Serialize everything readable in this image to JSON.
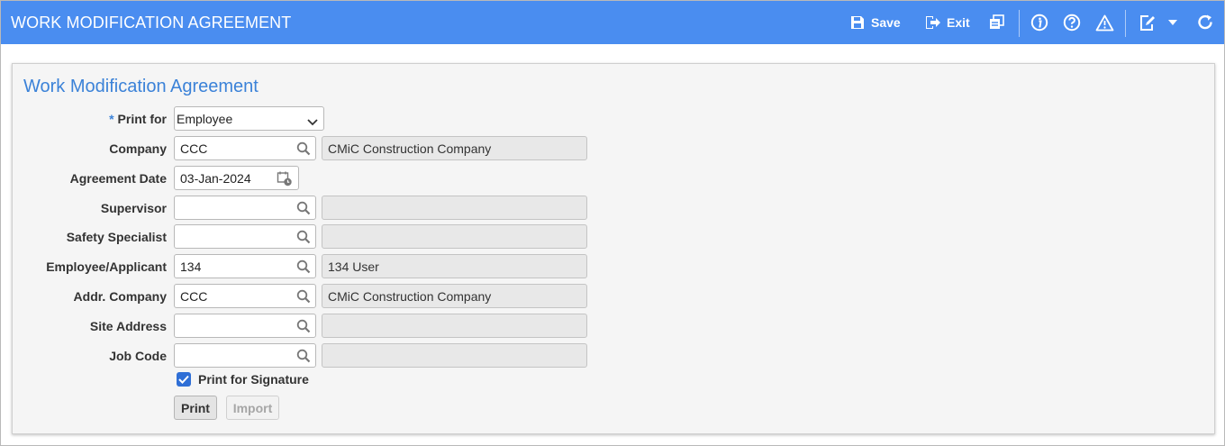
{
  "app": {
    "title": "WORK MODIFICATION AGREEMENT"
  },
  "toolbar": {
    "save_label": "Save",
    "exit_label": "Exit",
    "icons": [
      "save-icon",
      "exit-icon",
      "print-preview-icon",
      "info-icon",
      "help-icon",
      "warning-icon",
      "edit-note-icon",
      "dropdown-icon",
      "refresh-icon"
    ]
  },
  "form": {
    "title": "Work Modification Agreement",
    "required_marker": "*",
    "print_for": {
      "label": "Print for",
      "value": "Employee"
    },
    "company": {
      "label": "Company",
      "value": "CCC",
      "description": "CMiC Construction Company"
    },
    "agreement_date": {
      "label": "Agreement Date",
      "value": "03-Jan-2024"
    },
    "supervisor": {
      "label": "Supervisor",
      "value": "",
      "description": ""
    },
    "safety_specialist": {
      "label": "Safety Specialist",
      "value": "",
      "description": ""
    },
    "employee_applicant": {
      "label": "Employee/Applicant",
      "value": "134",
      "description": "134 User"
    },
    "addr_company": {
      "label": "Addr. Company",
      "value": "CCC",
      "description": "CMiC Construction Company"
    },
    "site_address": {
      "label": "Site Address",
      "value": "",
      "description": ""
    },
    "job_code": {
      "label": "Job Code",
      "value": "",
      "description": ""
    },
    "print_for_signature": {
      "label": "Print for Signature",
      "checked": true
    },
    "print_button": "Print",
    "import_button": "Import"
  },
  "colors": {
    "header": "#4a8df0",
    "accent": "#3b82d8",
    "checkbox": "#2f6fd6"
  }
}
